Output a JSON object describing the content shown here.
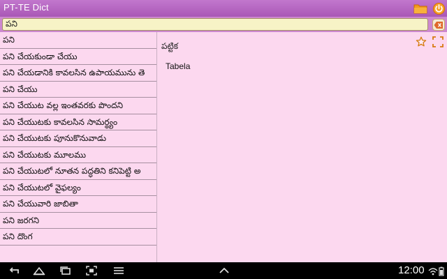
{
  "app": {
    "title": "PT-TE Dict"
  },
  "toolbar": {
    "folder_icon": "folder-icon",
    "power_icon": "power-icon"
  },
  "search": {
    "value": "పని",
    "clear_icon": "clear-icon"
  },
  "word_list": {
    "items": [
      "పని",
      "పని చేయకుండా చేయు",
      "పని చేయడానికి కావలసిన ఉపాయమును తె",
      "పని చేయు",
      "పని చేయుట వల్ల ఇంతవరకు పొందని",
      "పని చేయుటకు కావలసిన సామర్థ్యం",
      "పని చేయుటకు పూనుకొనువాడు",
      "పని చేయుటకు మూలము",
      "పని చేయుటలో నూతన పద్ధతిని కనిపెట్టి అ",
      "పని చేయుటలో వైఫల్యం",
      "పని చేయువారి జాబితా",
      "పని జరగని",
      "పని దొంగ"
    ]
  },
  "detail": {
    "headword": "పట్టిక",
    "translation": "Tabela",
    "star_icon": "star-icon",
    "expand_icon": "expand-icon"
  },
  "system_bar": {
    "time": "12:00",
    "accent": "#b55fc1"
  }
}
